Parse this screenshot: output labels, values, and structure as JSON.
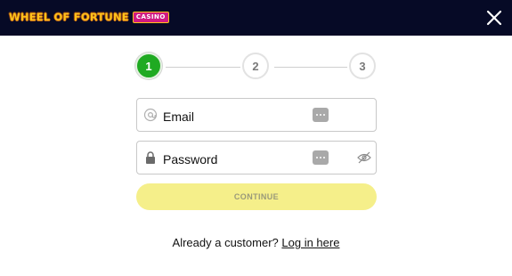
{
  "header": {
    "logo_text": "WHEEL OF FORTUNE",
    "logo_badge": "CASINO",
    "close_icon": "close-icon"
  },
  "stepper": {
    "current_step": 1,
    "steps": [
      {
        "label": "1",
        "state": "active"
      },
      {
        "label": "2",
        "state": "inactive"
      },
      {
        "label": "3",
        "state": "inactive"
      }
    ]
  },
  "form": {
    "email": {
      "label": "Email",
      "icon": "at-sign-icon",
      "autofill_icon": "password-manager-icon"
    },
    "password": {
      "label": "Password",
      "icon": "lock-icon",
      "autofill_icon": "password-manager-icon",
      "toggle_icon": "eye-slash-icon"
    },
    "continue_label": "CONTINUE"
  },
  "footer": {
    "prompt": "Already a customer?",
    "link": "Log in here"
  },
  "colors": {
    "topbar": "#060a26",
    "step_active": "#1faa22",
    "continue_bg": "#f5ef8a",
    "logo_gold": "#ffc21a",
    "logo_badge": "#d01a82"
  }
}
